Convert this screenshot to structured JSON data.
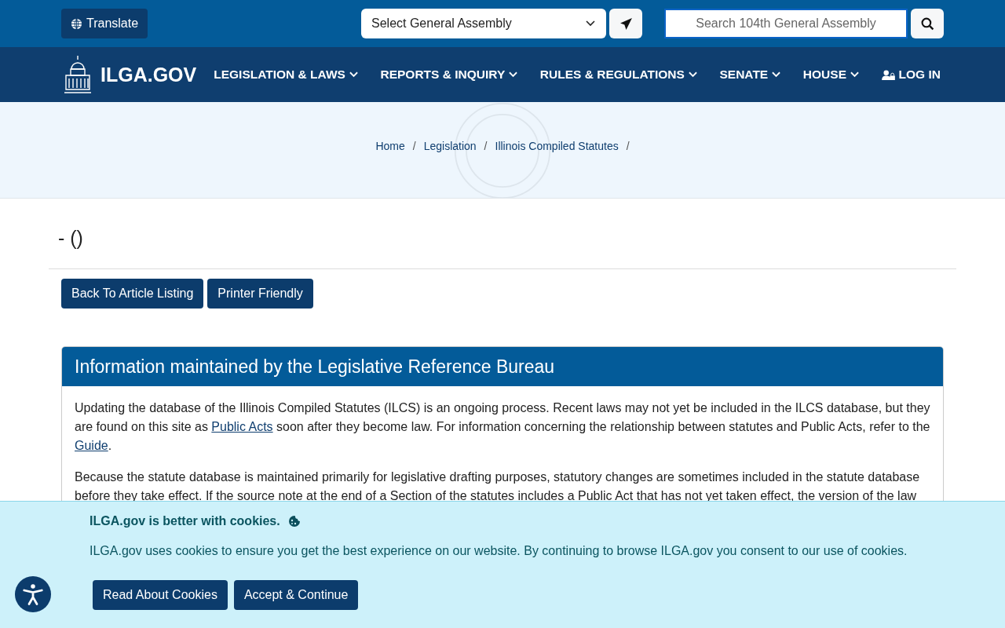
{
  "top_bar": {
    "translate_button": "Translate",
    "assembly_select": {
      "value": "Select General Assembly"
    },
    "search": {
      "placeholder": "Search 104th General Assembly"
    }
  },
  "nav": {
    "logo": "ILGA.GOV",
    "items": [
      {
        "label": "LEGISLATION & LAWS",
        "kind": "menu"
      },
      {
        "label": "REPORTS & INQUIRY",
        "kind": "menu"
      },
      {
        "label": "RULES & REGULATIONS",
        "kind": "menu"
      },
      {
        "label": "SENATE",
        "kind": "menu"
      },
      {
        "label": "HOUSE",
        "kind": "menu"
      },
      {
        "label": "LOG IN",
        "kind": "login"
      }
    ]
  },
  "breadcrumb": [
    {
      "label": "Home",
      "separator": "/"
    },
    {
      "label": "Legislation",
      "separator": "/"
    },
    {
      "label": "Illinois Compiled Statutes",
      "separator": "/"
    }
  ],
  "page_title": "- ()",
  "buttons": [
    "Back To Article Listing",
    "Printer Friendly"
  ],
  "info_card": {
    "title": "Information maintained by the Legislative Reference Bureau",
    "paragraphs": [
      [
        {
          "kind": "text",
          "text": "Updating the database of the Illinois Compiled Statutes (ILCS) is an ongoing process. Recent laws may not yet be included in the ILCS database, but they are found on this site as "
        },
        {
          "kind": "link",
          "text": "Public Acts"
        },
        {
          "kind": "text",
          "text": " soon after they become law. For information concerning the relationship between statutes and Public Acts, refer to the "
        },
        {
          "kind": "link",
          "text": "Guide"
        },
        {
          "kind": "text",
          "text": "."
        }
      ],
      [
        {
          "kind": "text",
          "text": "Because the statute database is maintained primarily for legislative drafting purposes, statutory changes are sometimes included in the statute database before they take effect. If the source note at the end of a Section of the statutes includes a Public Act that has not yet taken effect, the version of the law"
        }
      ]
    ]
  },
  "cookie_banner": {
    "title": "ILGA.gov is better with cookies.",
    "text": "ILGA.gov uses cookies to ensure you get the best experience on our website. By continuing to browse ILGA.gov you consent to our use of cookies.",
    "buttons": [
      "Read About Cookies",
      "Accept & Continue"
    ]
  }
}
